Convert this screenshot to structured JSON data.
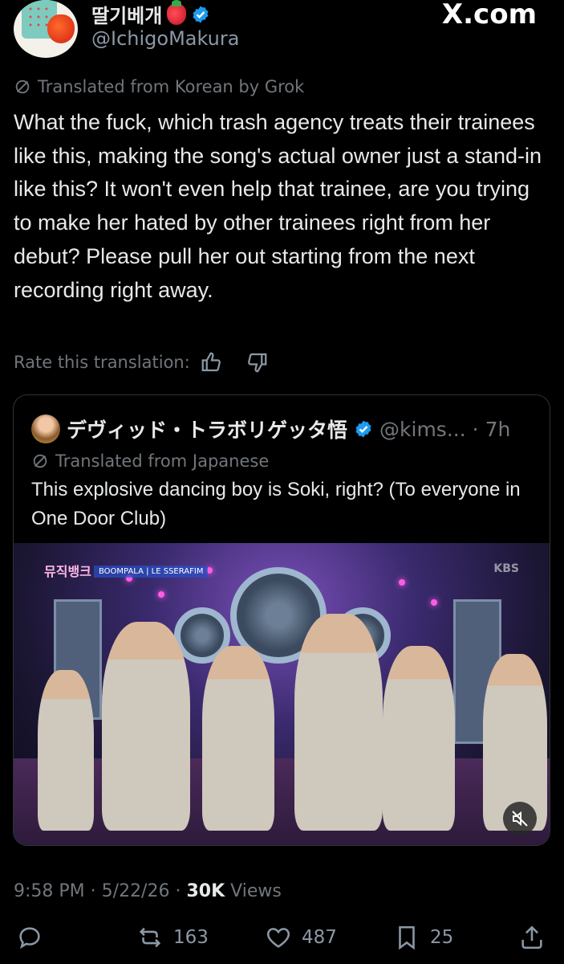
{
  "header": {
    "display_name": "딸기베개",
    "handle": "@IchigoMakura",
    "watermark": "X.com"
  },
  "tweet": {
    "translated_label": "Translated from Korean by Grok",
    "text": "What the fuck, which trash agency treats their trainees like this, making the song's actual owner just a stand-in like this? It won't even help that trainee, are you trying to make her hated by other trainees right from her debut? Please pull her out starting from the next recording right away.",
    "rate_label": "Rate this translation:"
  },
  "quote": {
    "name": "デヴィッド・トラボリゲッタ悟",
    "handle": "@kims...",
    "time": "· 7h",
    "translated_label": "Translated from Japanese",
    "text": "This explosive dancing boy is Soki, right? (To everyone in One Door Club)",
    "media": {
      "logo_text": "뮤직뱅크",
      "ticker_text": "BOOMPALA | LE SSERAFIM",
      "broadcaster": "KBS"
    }
  },
  "meta": {
    "time": "9:58 PM",
    "date": "5/22/26",
    "views_count": "30K",
    "views_label": "Views"
  },
  "actions": {
    "reposts": "163",
    "likes": "487",
    "bookmarks": "25"
  },
  "icons": {
    "verified": "verified-badge-icon",
    "translate": "translate-icon",
    "thumbs_up": "thumbs-up-icon",
    "thumbs_down": "thumbs-down-icon",
    "reply": "reply-icon",
    "repost": "repost-icon",
    "like": "heart-icon",
    "bookmark": "bookmark-icon",
    "share": "share-icon",
    "mute": "mute-icon"
  },
  "colors": {
    "verified": "#1d9bf0",
    "background": "#000000",
    "secondary_text": "#71767b"
  }
}
